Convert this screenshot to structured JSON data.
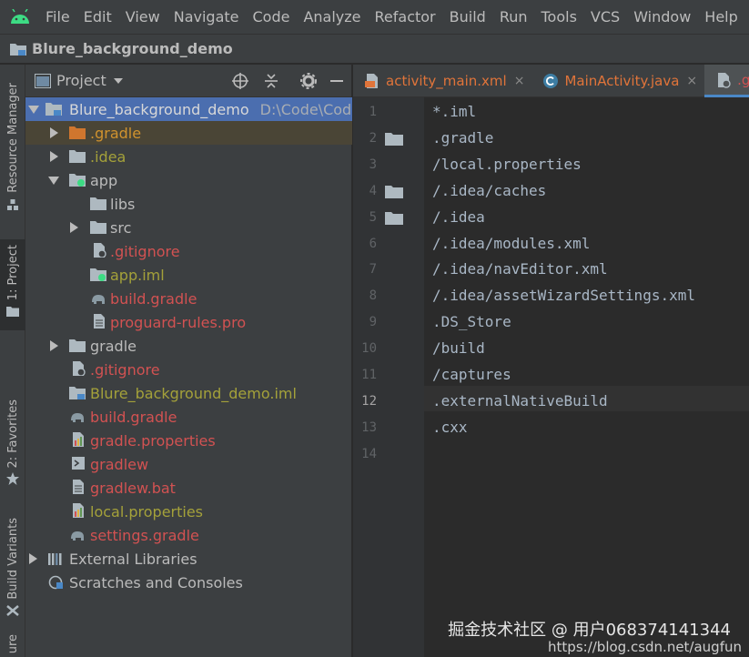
{
  "menu": [
    "File",
    "Edit",
    "View",
    "Navigate",
    "Code",
    "Analyze",
    "Refactor",
    "Build",
    "Run",
    "Tools",
    "VCS",
    "Window",
    "Help"
  ],
  "breadcrumb": "Blure_background_demo",
  "left_stripe": {
    "resource_manager": "Resource Manager",
    "project": "1: Project",
    "favorites": "2: Favorites",
    "build_variants": "Build Variants",
    "bottom": "ure"
  },
  "project_panel": {
    "title": "Project",
    "tree": [
      {
        "label": "Blure_background_demo",
        "path": "D:\\Code\\Code_f",
        "color": "white"
      },
      {
        "label": ".gradle",
        "color": "orange"
      },
      {
        "label": ".idea",
        "color": "olive"
      },
      {
        "label": "app",
        "color": "default"
      },
      {
        "label": "libs",
        "color": "default"
      },
      {
        "label": "src",
        "color": "default"
      },
      {
        "label": ".gitignore",
        "color": "red"
      },
      {
        "label": "app.iml",
        "color": "olive"
      },
      {
        "label": "build.gradle",
        "color": "red"
      },
      {
        "label": "proguard-rules.pro",
        "color": "red"
      },
      {
        "label": "gradle",
        "color": "default"
      },
      {
        "label": ".gitignore",
        "color": "red"
      },
      {
        "label": "Blure_background_demo.iml",
        "color": "olive"
      },
      {
        "label": "build.gradle",
        "color": "red"
      },
      {
        "label": "gradle.properties",
        "color": "red"
      },
      {
        "label": "gradlew",
        "color": "red"
      },
      {
        "label": "gradlew.bat",
        "color": "red"
      },
      {
        "label": "local.properties",
        "color": "olive"
      },
      {
        "label": "settings.gradle",
        "color": "red"
      },
      {
        "label": "External Libraries",
        "color": "default"
      },
      {
        "label": "Scratches and Consoles",
        "color": "default"
      }
    ]
  },
  "editor_tabs": [
    {
      "label": "activity_main.xml",
      "close": "×"
    },
    {
      "label": "MainActivity.java",
      "close": "×"
    },
    {
      "label": ".giti"
    }
  ],
  "editor": {
    "current_line": 12,
    "lines": [
      "*.iml",
      ".gradle",
      "/local.properties",
      "/.idea/caches",
      "/.idea",
      "/.idea/modules.xml",
      "/.idea/navEditor.xml",
      "/.idea/assetWizardSettings.xml",
      ".DS_Store",
      "/build",
      "/captures",
      ".externalNativeBuild",
      ".cxx",
      ""
    ],
    "line_numbers": [
      "1",
      "2",
      "3",
      "4",
      "5",
      "6",
      "7",
      "8",
      "9",
      "10",
      "11",
      "12",
      "13",
      "14"
    ]
  },
  "watermark": {
    "main": "掘金技术社区 @ 用户068374141344",
    "url": "https://blog.csdn.net/augfun"
  },
  "colors": {
    "selection": "#4b6eaf",
    "orange": "#d0922e",
    "olive": "#a4a13a",
    "red": "#d25252",
    "android_green": "#3ddc84"
  }
}
